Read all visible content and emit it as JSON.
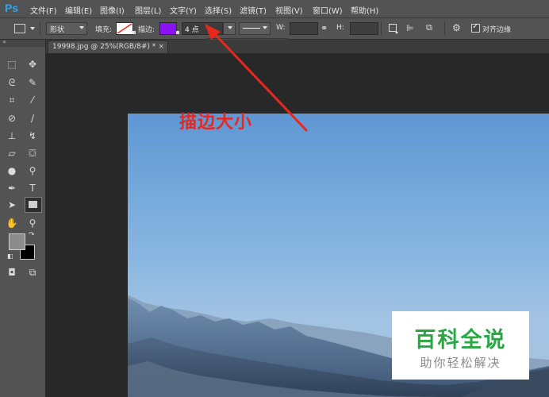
{
  "app": {
    "logo": "Ps"
  },
  "menu": [
    "文件(F)",
    "编辑(E)",
    "图像(I)",
    "图层(L)",
    "文字(Y)",
    "选择(S)",
    "滤镜(T)",
    "视图(V)",
    "窗口(W)",
    "帮助(H)"
  ],
  "options": {
    "mode_label": "形状",
    "fill_label": "填充:",
    "stroke_label": "描边:",
    "stroke_color": "#8a12f0",
    "stroke_size": "4 点",
    "w_label": "W:",
    "h_label": "H:",
    "align_edges_label": "对齐边缘",
    "align_edges_checked": true
  },
  "document": {
    "tab_label": "19998.jpg @ 25%(RGB/8#) *",
    "close_glyph": "×"
  },
  "annotation": {
    "text": "描边大小",
    "color": "#e8271e"
  },
  "watermark": {
    "main": "百科全说",
    "sub": "助你轻松解决"
  },
  "colors": {
    "foreground": "#8c8c8c",
    "background": "#000000"
  }
}
